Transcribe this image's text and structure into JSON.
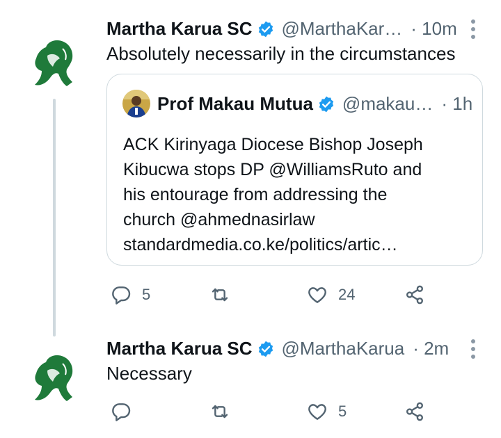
{
  "tweets": [
    {
      "name": "Martha Karua SC",
      "handle": "@MarthaKar…",
      "time": "· 10m",
      "text": "Absolutely necessarily in the circumstances",
      "quote": {
        "name": "Prof Makau Mutua",
        "handle": "@makau…",
        "time": "· 1h",
        "lines": [
          "ACK Kirinyaga Diocese Bishop Joseph",
          "Kibucwa stops DP @WilliamsRuto and",
          "his entourage from addressing the",
          "church @ahmednasirlaw",
          "standardmedia.co.ke/politics/artic…"
        ]
      },
      "actions": {
        "reply_count": "5",
        "retweet_count": "",
        "like_count": "24"
      }
    },
    {
      "name": "Martha Karua SC",
      "handle": "@MarthaKarua",
      "time": "· 2m",
      "text": "Necessary",
      "actions": {
        "reply_count": "",
        "retweet_count": "",
        "like_count": "5"
      }
    }
  ],
  "icons": {
    "verified": "verified-badge-icon",
    "reply": "reply-icon",
    "retweet": "retweet-icon",
    "like": "heart-icon",
    "share": "share-icon",
    "more": "more-vertical-icon"
  },
  "colors": {
    "accent": "#1d9bf0",
    "muted": "#536471",
    "avatar_green": "#1f7a3a"
  }
}
